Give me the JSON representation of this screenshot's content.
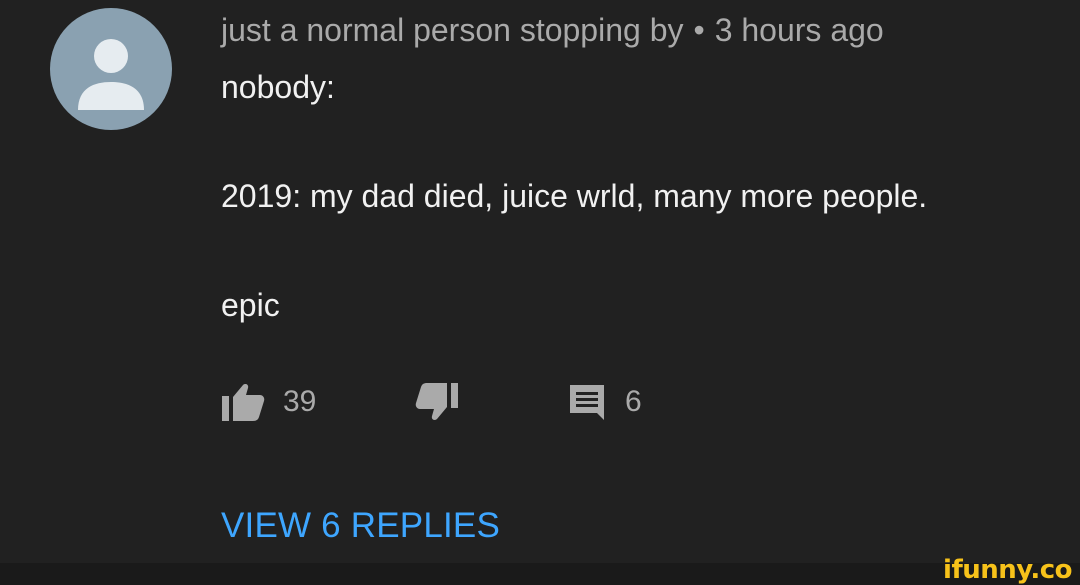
{
  "comment": {
    "author": "just a normal person stopping by",
    "separator": "•",
    "timestamp": "3 hours ago",
    "lines": [
      "nobody:",
      "2019: my dad died, juice wrld, many more people.",
      "epic"
    ],
    "likes": "39",
    "replies_count": "6",
    "view_replies_label": "VIEW 6 REPLIES"
  },
  "icons": {
    "avatar": "default-avatar-icon",
    "like": "thumbs-up-icon",
    "dislike": "thumbs-down-icon",
    "reply": "comment-icon"
  },
  "colors": {
    "background": "#212121",
    "link": "#3ea6ff",
    "secondary_text": "#aaaaaa",
    "primary_text": "#f1f1f1",
    "avatar_bg": "#8aa1b1",
    "watermark": "#f7c21a"
  },
  "watermark": "ifunny.co"
}
